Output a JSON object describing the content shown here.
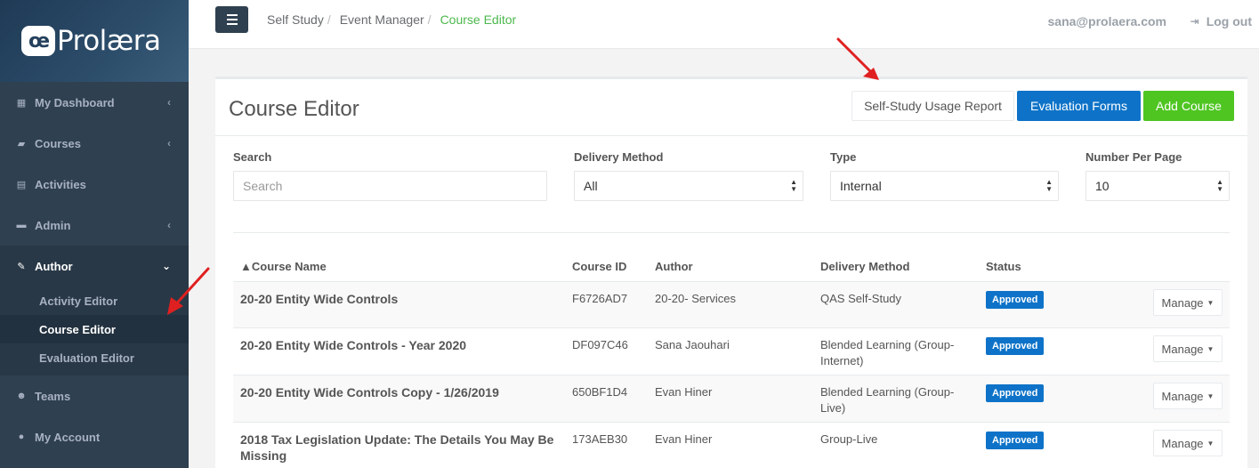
{
  "app": {
    "logo_mark": "œ",
    "logo_text": "Prolæra"
  },
  "sidebar": {
    "items": [
      {
        "label": "My Dashboard",
        "icon": "dashboard-icon",
        "glyph": "▦",
        "chevron": "‹"
      },
      {
        "label": "Courses",
        "icon": "book-icon",
        "glyph": "▰",
        "chevron": "‹"
      },
      {
        "label": "Activities",
        "icon": "document-icon",
        "glyph": "▤",
        "chevron": ""
      },
      {
        "label": "Admin",
        "icon": "card-icon",
        "glyph": "▬",
        "chevron": "‹"
      },
      {
        "label": "Author",
        "icon": "pencil-icon",
        "glyph": "✎",
        "chevron": "⌄"
      },
      {
        "label": "Teams",
        "icon": "users-icon",
        "glyph": "☻",
        "chevron": ""
      },
      {
        "label": "My Account",
        "icon": "user-icon",
        "glyph": "●",
        "chevron": ""
      }
    ],
    "author_sub": [
      "Activity Editor",
      "Course Editor",
      "Evaluation Editor"
    ]
  },
  "topbar": {
    "breadcrumb": [
      "Self Study",
      "Event Manager",
      "Course Editor"
    ],
    "separator": "/",
    "user_email": "sana@prolaera.com",
    "logout_label": "Log out",
    "logout_glyph": "⇥"
  },
  "page": {
    "title": "Course Editor",
    "buttons": {
      "usage_report": "Self-Study Usage Report",
      "evaluation_forms": "Evaluation Forms",
      "add_course": "Add Course"
    }
  },
  "filters": {
    "search": {
      "label": "Search",
      "placeholder": "Search"
    },
    "delivery": {
      "label": "Delivery Method",
      "value": "All"
    },
    "type": {
      "label": "Type",
      "value": "Internal"
    },
    "number": {
      "label": "Number Per Page",
      "value": "10"
    }
  },
  "table": {
    "headers": [
      "▲Course Name",
      "Course ID",
      "Author",
      "Delivery Method",
      "Status"
    ],
    "rows": [
      {
        "name": "20-20 Entity Wide Controls",
        "id": "F6726AD7",
        "author": "20-20- Services",
        "delivery": "QAS Self-Study",
        "status": "Approved",
        "action": "Manage"
      },
      {
        "name": "20-20 Entity Wide Controls - Year 2020",
        "id": "DF097C46",
        "author": "Sana Jaouhari",
        "delivery": "Blended Learning (Group-Internet)",
        "status": "Approved",
        "action": "Manage"
      },
      {
        "name": "20-20 Entity Wide Controls Copy - 1/26/2019",
        "id": "650BF1D4",
        "author": "Evan Hiner",
        "delivery": "Blended Learning (Group-Live)",
        "status": "Approved",
        "action": "Manage"
      },
      {
        "name": "2018 Tax Legislation Update: The Details You May Be Missing",
        "id": "173AEB30",
        "author": "Evan Hiner",
        "delivery": "Group-Live",
        "status": "Approved",
        "action": "Manage"
      }
    ]
  },
  "colors": {
    "sidebar_bg": "#2f4050",
    "accent_green": "#4fc522",
    "accent_blue": "#0e73c8",
    "breadcrumb_active": "#4cb84c",
    "annotation_arrow": "#e02020"
  }
}
